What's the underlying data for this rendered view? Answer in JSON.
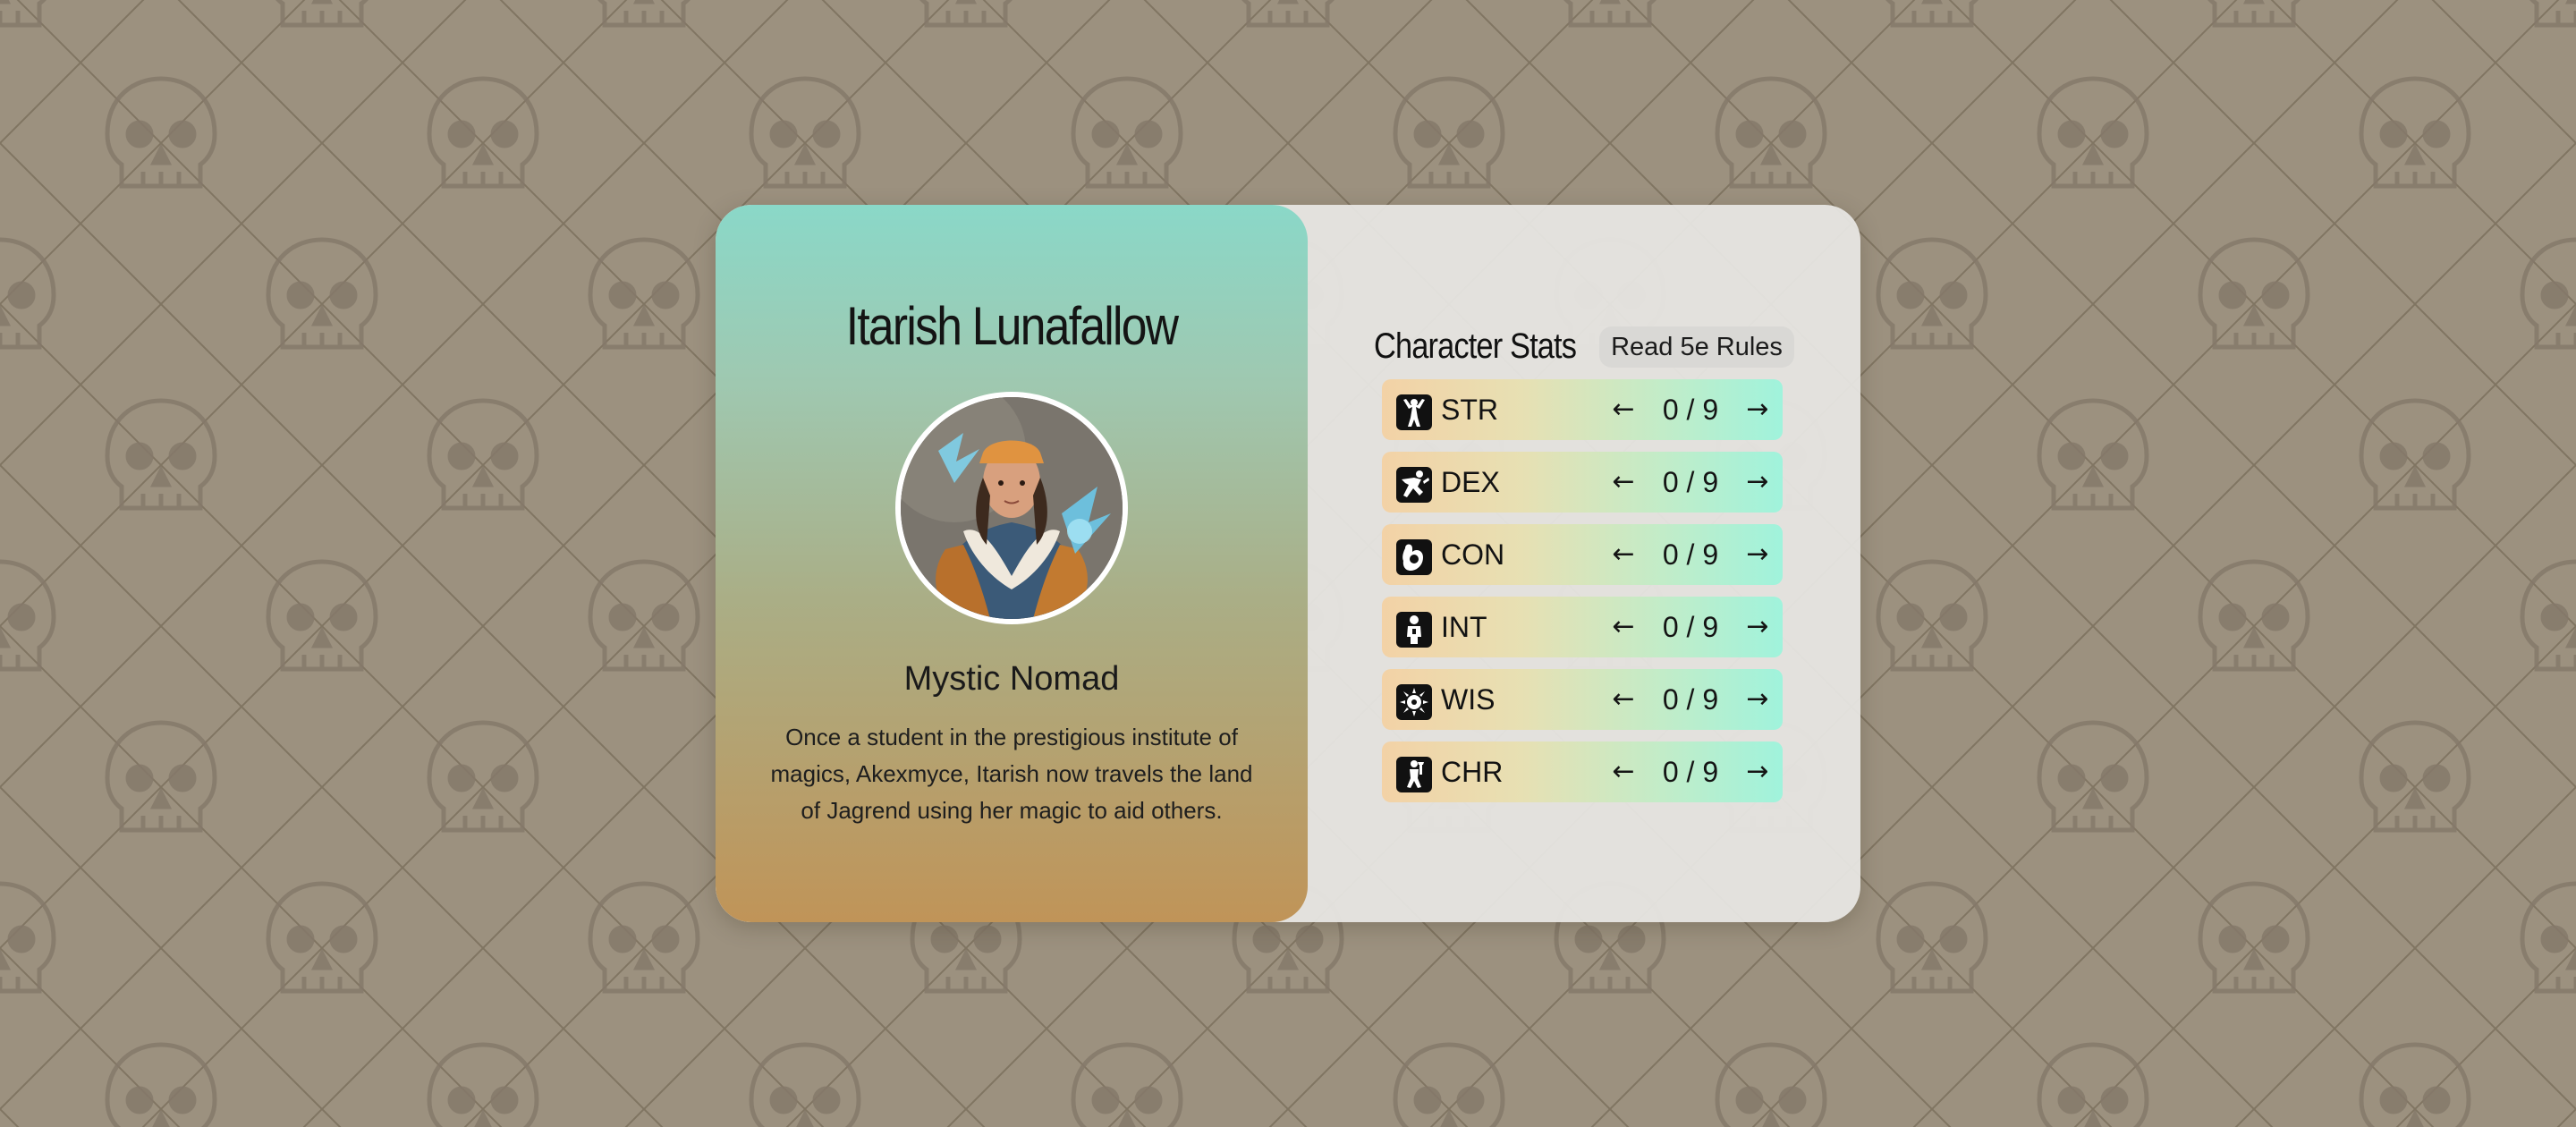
{
  "background": {
    "color": "#9c917f",
    "pattern_icon": "skull-icon"
  },
  "profile": {
    "name": "Itarish Lunafallow",
    "portrait_icon": "character-portrait",
    "class_name": "Mystic Nomad",
    "bio": "Once a student in the prestigious institute of magics, Akexmyce, Itarish now travels the land of Jagrend using her magic to aid others."
  },
  "stats": {
    "title": "Character Stats",
    "rules_button_label": "Read 5e Rules",
    "prev_arrow": "←",
    "next_arrow": "→",
    "separator": "/",
    "items": [
      {
        "label": "STR",
        "icon": "strength-icon",
        "value": "0",
        "max": "9"
      },
      {
        "label": "DEX",
        "icon": "dexterity-icon",
        "value": "0",
        "max": "9"
      },
      {
        "label": "CON",
        "icon": "constitution-icon",
        "value": "0",
        "max": "9"
      },
      {
        "label": "INT",
        "icon": "intelligence-icon",
        "value": "0",
        "max": "9"
      },
      {
        "label": "WIS",
        "icon": "wisdom-icon",
        "value": "0",
        "max": "9"
      },
      {
        "label": "CHR",
        "icon": "charisma-icon",
        "value": "0",
        "max": "9"
      }
    ]
  },
  "colors": {
    "profile_top": "#8ad8c8",
    "profile_bottom": "#c09458",
    "stat_row_left": "#f3d2a6",
    "stat_row_right": "#a0f3dc"
  }
}
